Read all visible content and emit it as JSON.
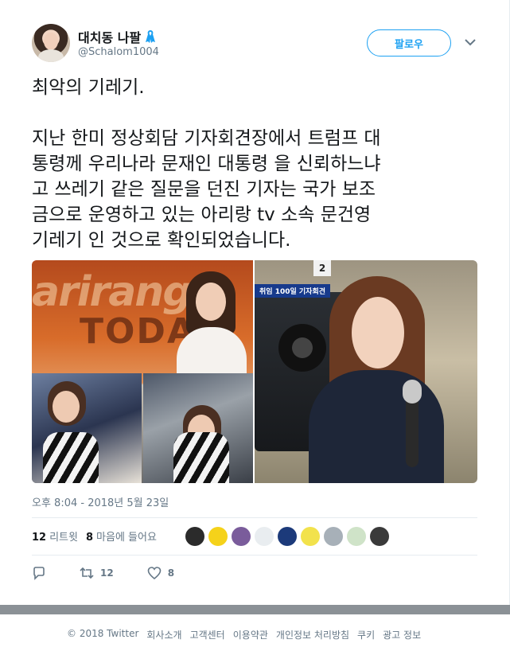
{
  "author": {
    "display_name": "대치동 나팔",
    "handle": "@Schalom1004",
    "badge_icon": "ribbon-icon",
    "badge_color": "#1da1f2"
  },
  "follow_label": "팔로우",
  "tweet": {
    "text": "최악의 기레기.\n\n지난 한미 정상회담 기자회견장에서 트럼프 대통령께 우리나라 문재인 대통령 을 신뢰하느냐고 쓰레기 같은 질문을 던진 기자는 국가 보조금으로 운영하고 있는 아리랑 tv 소속 문건영 기레기 인 것으로 확인되었습니다.",
    "text_lines": [
      "최악의 기레기.",
      "",
      "지난 한미 정상회담 기자회견장에서 트럼프 대",
      "통령께 우리나라 문재인 대통령 을 신뢰하느냐",
      "고 쓰레기 같은 질문을 던진 기자는 국가 보조",
      "금으로 운영하고 있는 아리랑 tv 소속 문건영",
      "기레기 인 것으로 확인되었습니다."
    ],
    "timestamp": "오후 8:04 - 2018년 5월 23일"
  },
  "media": {
    "left_logo_text": "arirang",
    "left_show_text": "TODAY",
    "right_caption": "취임 100일 기자회견",
    "right_number": "2"
  },
  "stats": {
    "retweets_count": "12",
    "retweets_label": "리트윗",
    "likes_count": "8",
    "likes_label": "마음에 들어요"
  },
  "likers": [
    {
      "icon": "liker-avatar-1",
      "color": "#2b2b2b"
    },
    {
      "icon": "liker-avatar-2",
      "color": "#f5d21a"
    },
    {
      "icon": "liker-avatar-3",
      "color": "#7a5c9b"
    },
    {
      "icon": "liker-avatar-4",
      "color": "#e9edf0"
    },
    {
      "icon": "liker-avatar-5",
      "color": "#1c3a7a"
    },
    {
      "icon": "liker-avatar-6",
      "color": "#f2e24c"
    },
    {
      "icon": "liker-avatar-7",
      "color": "#a7b0b8"
    },
    {
      "icon": "liker-avatar-8",
      "color": "#cfe3c8"
    },
    {
      "icon": "liker-avatar-9",
      "color": "#3a3a3a"
    }
  ],
  "actions": {
    "reply_icon": "reply-icon",
    "retweet_icon": "retweet-icon",
    "retweet_count": "12",
    "like_icon": "heart-icon",
    "like_count": "8"
  },
  "footer": {
    "copyright": "© 2018 Twitter",
    "links": [
      "회사소개",
      "고객센터",
      "이용약관",
      "개인정보 처리방침",
      "쿠키",
      "광고 정보"
    ]
  },
  "colors": {
    "accent": "#1da1f2",
    "muted": "#657786",
    "text": "#14171a"
  }
}
